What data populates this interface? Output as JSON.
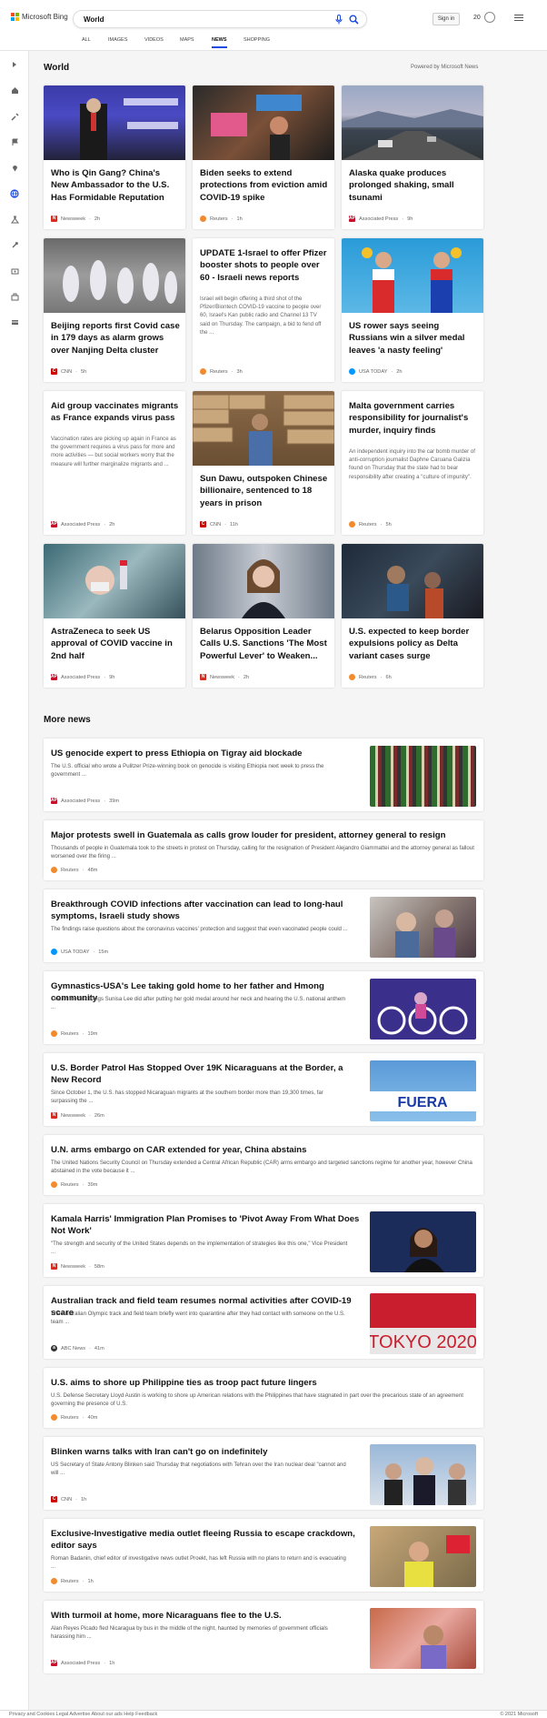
{
  "header": {
    "logo_text": "Microsoft Bing",
    "query": "World",
    "sign_in": "Sign in",
    "rewards_points": "20"
  },
  "tabs": [
    "ALL",
    "IMAGES",
    "VIDEOS",
    "MAPS",
    "NEWS",
    "SHOPPING"
  ],
  "active_tab": "NEWS",
  "world": {
    "title": "World",
    "powered_by": "Powered by Microsoft News"
  },
  "cards": [
    {
      "title": "Who is Qin Gang? China's New Ambassador to the U.S. Has Formidable Reputation",
      "source": "Newsweek",
      "time": "2h",
      "image": "qin-gang-podium-photo"
    },
    {
      "title": "Biden seeks to extend protections from eviction amid COVID-19 spike",
      "source": "Reuters",
      "time": "1h",
      "image": "eviction-protest-photo"
    },
    {
      "title": "Alaska quake produces prolonged shaking, small tsunami",
      "source": "Associated Press",
      "time": "9h",
      "image": "alaska-highway-photo"
    },
    {
      "title": "Beijing reports first Covid case in 179 days as alarm grows over Nanjing Delta cluster",
      "source": "CNN",
      "time": "5h",
      "image": "hazmat-workers-photo"
    },
    {
      "title": "UPDATE 1-Israel to offer Pfizer booster shots to people over 60 - Israeli news reports",
      "desc": "Israel will begin offering a third shot of the Pfizer/Biontech COVID-19 vaccine to people over 60, Israel's Kan public radio and Channel 13 TV said on Thursday. The campaign, a bid to fend off the ...",
      "source": "Reuters",
      "time": "3h"
    },
    {
      "title": "US rower says seeing Russians win a silver medal leaves 'a nasty feeling'",
      "source": "USA TODAY",
      "time": "2h",
      "image": "rowers-medal-photo"
    },
    {
      "title": "Aid group vaccinates migrants as France expands virus pass",
      "desc": "Vaccination rates are picking up again in France as the government requires a virus pass for more and more activities — but social workers worry that the measure will further marginalize migrants and ...",
      "source": "Associated Press",
      "time": "2h"
    },
    {
      "title": "Sun Dawu, outspoken Chinese billionaire, sentenced to 18 years in prison",
      "source": "CNN",
      "time": "11h",
      "image": "sun-dawu-photo"
    },
    {
      "title": "Malta government carries responsibility for journalist's murder, inquiry finds",
      "desc": "An independent inquiry into the car bomb murder of anti-corruption journalist Daphne Caruana Galizia found on Thursday that the state had to bear responsibility after creating a \"culture of impunity\".",
      "source": "Reuters",
      "time": "5h"
    },
    {
      "title": "AstraZeneca to seek US approval of COVID vaccine in 2nd half",
      "source": "Associated Press",
      "time": "9h",
      "image": "vaccine-vial-photo"
    },
    {
      "title": "Belarus Opposition Leader Calls U.S. Sanctions 'The Most Powerful Lever' to Weaken...",
      "source": "Newsweek",
      "time": "2h",
      "image": "belarus-leader-photo"
    },
    {
      "title": "U.S. expected to keep border expulsions policy as Delta variant cases surge",
      "source": "Reuters",
      "time": "6h",
      "image": "border-crossing-photo"
    }
  ],
  "more_news": {
    "title": "More news",
    "items": [
      {
        "title": "US genocide expert to press Ethiopia on Tigray aid blockade",
        "desc": "The U.S. official who wrote a Pulitzer Prize-winning book on genocide is visiting Ethiopia next week to press the government ...",
        "source": "Associated Press",
        "time": "39m",
        "image": "ethiopia-crowd-photo"
      },
      {
        "title": "Major protests swell in Guatemala as calls grow louder for president, attorney general to resign",
        "desc": "Thousands of people in Guatemala took to the streets in protest on Thursday, calling for the resignation of President Alejandro Giammattei and the attorney general as fallout worsened over the firing ...",
        "source": "Reuters",
        "time": "48m"
      },
      {
        "title": "Breakthrough COVID infections after vaccination can lead to long-haul symptoms, Israeli study shows",
        "desc": "The findings raise questions about the coronavirus vaccines' protection and suggest that even vaccinated people could ...",
        "source": "USA TODAY",
        "time": "15m",
        "image": "vaccination-photo"
      },
      {
        "title": "Gymnastics-USA's Lee taking gold home to her father and Hmong community",
        "desc": "One of the first things Sunisa Lee did after putting her gold medal around her neck and hearing the U.S. national anthem ...",
        "source": "Reuters",
        "time": "19m",
        "image": "olympic-rings-photo"
      },
      {
        "title": "U.S. Border Patrol Has Stopped Over 19K Nicaraguans at the Border, a New Record",
        "desc": "Since October 1, the U.S. has stopped Nicaraguan migrants at the southern border more than 19,300 times, far surpassing the ...",
        "source": "Newsweek",
        "time": "26m",
        "image": "fuera-protest-photo"
      },
      {
        "title": "U.N. arms embargo on CAR extended for year, China abstains",
        "desc": "The United Nations Security Council on Thursday extended a Central African Republic (CAR) arms embargo and targeted sanctions regime for another year, however China abstained in the vote because it ...",
        "source": "Reuters",
        "time": "39m"
      },
      {
        "title": "Kamala Harris' Immigration Plan Promises to 'Pivot Away From What Does Not Work'",
        "desc": "\"The strength and security of the United States depends on the implementation of strategies like this one,\" Vice President ...",
        "source": "Newsweek",
        "time": "58m",
        "image": "harris-photo"
      },
      {
        "title": "Australian track and field team resumes normal activities after COVID-19 scare",
        "desc": "The Australian Olympic track and field team briefly went into quarantine after they had contact with someone on the U.S. team ...",
        "source": "ABC News",
        "time": "41m",
        "image": "tokyo-2020-photo"
      },
      {
        "title": "U.S. aims to shore up Philippine ties as troop pact future lingers",
        "desc": "U.S. Defense Secretary Lloyd Austin is working to shore up American relations with the Philippines that have stagnated in part over the precarious state of an agreement governing the presence of U.S.",
        "source": "Reuters",
        "time": "40m"
      },
      {
        "title": "Blinken warns talks with Iran can't go on indefinitely",
        "desc": "US Secretary of State Antony Blinken said Thursday that negotiations with Tehran over the Iran nuclear deal \"cannot and will ...",
        "source": "CNN",
        "time": "1h",
        "image": "blinken-photo"
      },
      {
        "title": "Exclusive-Investigative media outlet fleeing Russia to escape crackdown, editor says",
        "desc": "Roman Badanin, chief editor of investigative news outlet Proekt, has left Russia with no plans to return and is evacuating ...",
        "source": "Reuters",
        "time": "1h",
        "image": "editor-photo"
      },
      {
        "title": "With turmoil at home, more Nicaraguans flee to the U.S.",
        "desc": "Alan Reyes Picado fled Nicaragua by bus in the middle of the night, haunted by memories of government officials harassing him ...",
        "source": "Associated Press",
        "time": "1h",
        "image": "nicaraguan-man-photo"
      }
    ]
  },
  "footer": {
    "left": "Privacy and Cookies  Legal  Advertise  About our ads  Help  Feedback",
    "right": "© 2021 Microsoft"
  },
  "colors": {
    "accent": "#174ae4",
    "newsweek": "#d62d20",
    "reuters": "#f28a2e",
    "ap": "#c8102e",
    "cnn": "#cc0000",
    "usatoday": "#0098fe",
    "abc": "#333333"
  }
}
